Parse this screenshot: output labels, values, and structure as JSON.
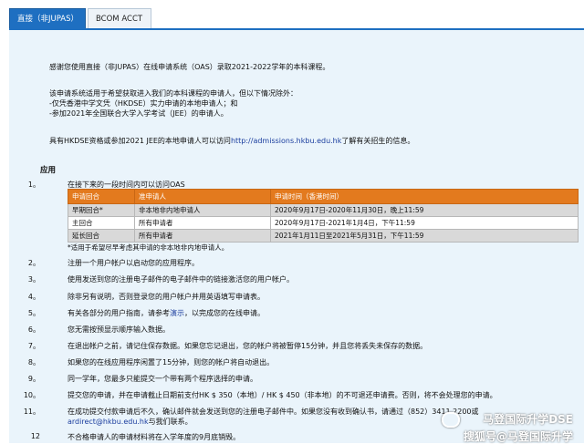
{
  "tabs": [
    {
      "label": "直接（非JUPAS）",
      "active": true
    },
    {
      "label": "BCOM ACCT",
      "active": false
    }
  ],
  "intro": {
    "line1": "感谢您使用直接（非JUPAS）在线申请系统（OAS）录取2021-2022学年的本科课程。",
    "line2": "该申请系统适用于希望获取进入我们的本科课程的申请人，但以下情况除外：",
    "line3": "-仅凭香港中学文凭（HKDSE）实力申请的本地申请人；和",
    "line4": "-参加2021年全国联合大学入学考试（JEE）的申请人。",
    "line5_pre": "具有HKDSE资格或参加2021 JEE的本地申请人可以访问",
    "line5_link": "http://admissions.hkbu.edu.hk",
    "line5_post": "了解有关招生的信息。"
  },
  "section_title": "应用",
  "item1": "在接下来的一段时间内可以访问OAS",
  "table": {
    "headers": [
      "申请回合",
      "准申请人",
      "申请时间（香港时间）"
    ],
    "rows": [
      [
        "早期回合*",
        "非本地非内地申请人",
        "2020年9月17日-2020年11月30日，晚上11:59"
      ],
      [
        "主回合",
        "所有申请者",
        "2020年9月17日-2021年1月4日，下午11:59"
      ],
      [
        "延长回合",
        "所有申请者",
        "2021年1月11日至2021年5月31日，下午11:59"
      ]
    ]
  },
  "note": "*适用于希望尽早考虑其申请的非本地非内地申请人。",
  "items": [
    {
      "num": "2。",
      "text": "注册一个用户帐户以启动您的应用程序。"
    },
    {
      "num": "3。",
      "text": "使用发送到您的注册电子邮件的电子邮件中的链接激活您的用户帐户。"
    },
    {
      "num": "4。",
      "text": "除非另有说明，否则登录您的用户帐户并用英语填写申请表。"
    },
    {
      "num": "5。",
      "text_pre": "有关各部分的用户指南，请参考",
      "link": "演示",
      "text_post": "，以完成您的在线申请。"
    },
    {
      "num": "6。",
      "text": "您无需按预显示顺序输入数据。"
    },
    {
      "num": "7。",
      "text": "在退出帐户之前，请记住保存数据。如果您忘记退出，您的帐户将被暂停15分钟，并且您将丢失未保存的数据。"
    },
    {
      "num": "8。",
      "text": "如果您的在线应用程序闲置了15分钟，则您的帐户将自动退出。"
    },
    {
      "num": "9。",
      "text": "同一学年，您最多只能提交一个带有两个程序选择的申请。"
    },
    {
      "num": "10。",
      "text": "提交您的申请，并在申请截止日期前支付HK $ 350（本地）/ HK $ 450（非本地）的不可退还申请费。否则，将不会处理您的申请。"
    },
    {
      "num": "11。",
      "text": "在成功提交付款申请后不久，确认邮件就会发送到您的注册电子邮件中。如果您没有收到确认书，请通过（852）3411 2200或",
      "text2_link": "ardirect@hkbu.edu.hk",
      "text2_post": "与我们联系。"
    },
    {
      "num": "12",
      "text": "不合格申请人的申请材料将在入学年度的9月底销毁。"
    }
  ],
  "watermark": {
    "line1": "马登国际升学DSE",
    "line2": "搜狐号@马登国际升学"
  }
}
